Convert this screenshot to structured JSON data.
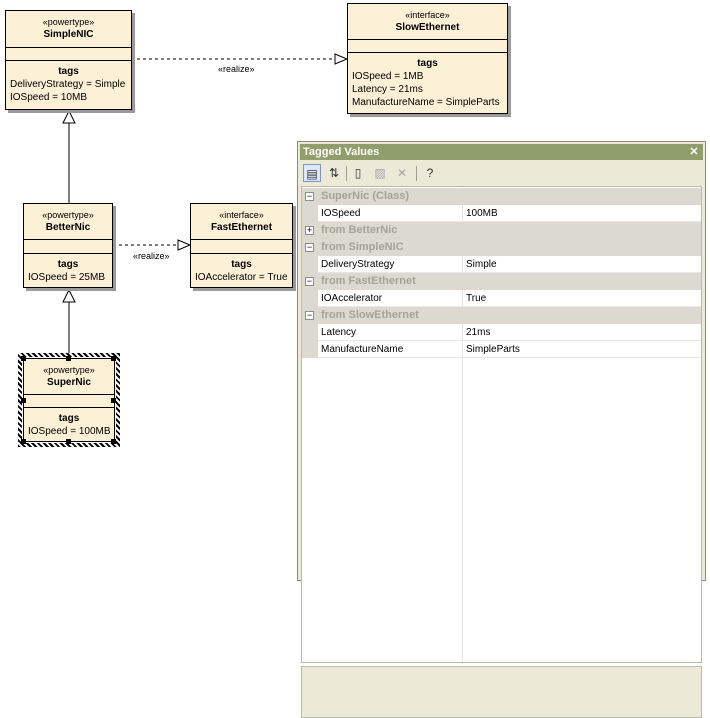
{
  "classes": {
    "simplenic": {
      "stereotype": "«powertype»",
      "name": "SimpleNIC",
      "tags_title": "tags",
      "tags": [
        "DeliveryStrategy = Simple",
        "IOSpeed = 10MB"
      ]
    },
    "slowethernet": {
      "stereotype": "«interface»",
      "name": "SlowEthernet",
      "tags_title": "tags",
      "tags": [
        "IOSpeed = 1MB",
        "Latency = 21ms",
        "ManufactureName = SimpleParts"
      ]
    },
    "betternic": {
      "stereotype": "«powertype»",
      "name": "BetterNic",
      "tags_title": "tags",
      "tags": [
        "IOSpeed = 25MB"
      ]
    },
    "fastethernet": {
      "stereotype": "«interface»",
      "name": "FastEthernet",
      "tags_title": "tags",
      "tags": [
        "IOAccelerator = True"
      ]
    },
    "supernic": {
      "stereotype": "«powertype»",
      "name": "SuperNic",
      "tags_title": "tags",
      "tags": [
        "IOSpeed = 100MB"
      ]
    }
  },
  "edges": {
    "realize_top": "«realize»",
    "realize_mid": "«realize»"
  },
  "panel": {
    "title": "Tagged Values",
    "close": "✕",
    "toolbar": [
      {
        "name": "categorize-icon",
        "glyph": "▤"
      },
      {
        "name": "sort-az-icon",
        "glyph": "⇅"
      },
      {
        "name": "new-tag-icon",
        "glyph": "▯"
      },
      {
        "name": "edit-tag-icon",
        "glyph": "▨"
      },
      {
        "name": "delete-tag-icon",
        "glyph": "✕"
      },
      {
        "name": "help-icon",
        "glyph": "?"
      }
    ],
    "groups": [
      {
        "label": "SuperNic (Class)",
        "expanded": true,
        "rows": [
          {
            "key": "IOSpeed",
            "value": "100MB"
          }
        ]
      },
      {
        "label": "from BetterNic",
        "expanded": false,
        "rows": []
      },
      {
        "label": "from SimpleNIC",
        "expanded": true,
        "rows": [
          {
            "key": "DeliveryStrategy",
            "value": "Simple"
          }
        ]
      },
      {
        "label": "from FastEthernet",
        "expanded": true,
        "rows": [
          {
            "key": "IOAccelerator",
            "value": "True"
          }
        ]
      },
      {
        "label": "from SlowEthernet",
        "expanded": true,
        "rows": [
          {
            "key": "Latency",
            "value": "21ms"
          },
          {
            "key": "ManufactureName",
            "value": "SimpleParts"
          }
        ]
      }
    ]
  }
}
